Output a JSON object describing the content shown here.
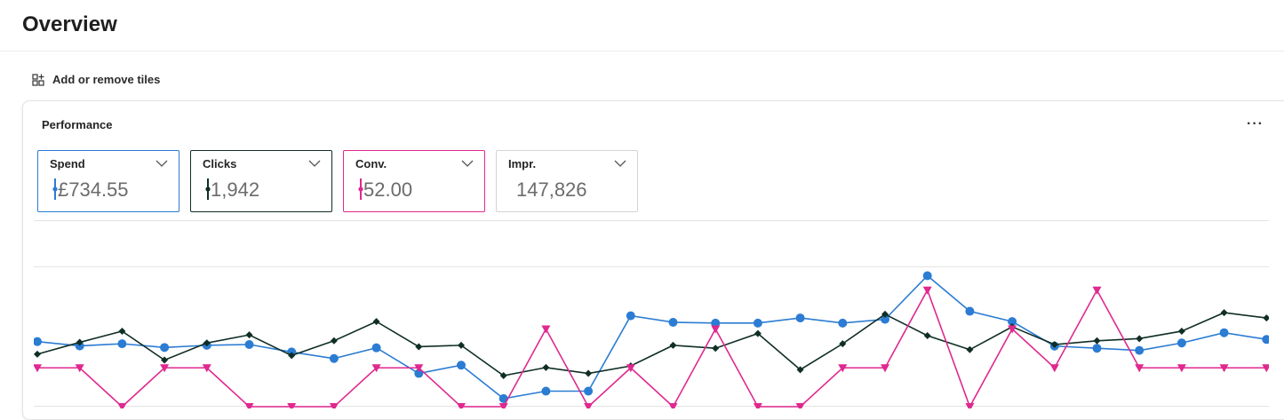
{
  "header": {
    "title": "Overview"
  },
  "toolbar": {
    "add_tiles_label": "Add or remove tiles"
  },
  "card": {
    "title": "Performance",
    "more_label": "···"
  },
  "metrics": [
    {
      "label": "Spend",
      "value": "£734.55",
      "color": "#2b7cd3",
      "selected": true
    },
    {
      "label": "Clicks",
      "value": "1,942",
      "color": "#0f2e26",
      "selected": true
    },
    {
      "label": "Conv.",
      "value": "52.00",
      "color": "#e0288f",
      "selected": true
    },
    {
      "label": "Impr.",
      "value": "147,826",
      "color": "",
      "selected": false
    }
  ],
  "chart_data": {
    "type": "line",
    "x": [
      1,
      2,
      3,
      4,
      5,
      6,
      7,
      8,
      9,
      10,
      11,
      12,
      13,
      14,
      15,
      16,
      17,
      18,
      19,
      20,
      21,
      22,
      23,
      24,
      25,
      26,
      27,
      28,
      29,
      30
    ],
    "ylim": [
      0,
      100
    ],
    "grid": true,
    "series": [
      {
        "name": "Spend",
        "color": "#2b7cd3",
        "marker": "circle",
        "values": [
          41.9,
          39.1,
          40.5,
          38.1,
          39.5,
          40.0,
          35.2,
          31.0,
          37.9,
          21.4,
          26.7,
          5.2,
          10.0,
          10.0,
          58.5,
          54.3,
          53.8,
          53.8,
          57.1,
          53.8,
          56.2,
          84.3,
          61.4,
          54.8,
          39.0,
          37.6,
          36.2,
          41.0,
          47.6,
          43.3
        ],
        "label": "Spend"
      },
      {
        "name": "Clicks",
        "color": "#0f2e26",
        "marker": "diamond",
        "values": [
          33.8,
          41.4,
          48.6,
          30.0,
          41.0,
          46.2,
          32.9,
          42.4,
          54.8,
          38.6,
          39.5,
          20.0,
          25.2,
          21.4,
          26.2,
          39.5,
          37.6,
          47.1,
          23.8,
          40.5,
          59.5,
          45.7,
          36.7,
          51.4,
          40.0,
          42.4,
          43.8,
          48.6,
          60.5,
          57.1
        ],
        "label": "Clicks"
      },
      {
        "name": "Conv.",
        "color": "#e0288f",
        "marker": "triangle-down",
        "values": [
          25,
          25,
          0,
          25,
          25,
          0,
          0,
          0,
          25,
          25,
          0,
          0,
          50,
          0,
          25,
          0,
          50,
          0,
          0,
          25,
          25,
          75,
          0,
          50,
          25,
          75,
          25,
          25,
          25,
          25
        ],
        "label": "Conv."
      }
    ]
  }
}
